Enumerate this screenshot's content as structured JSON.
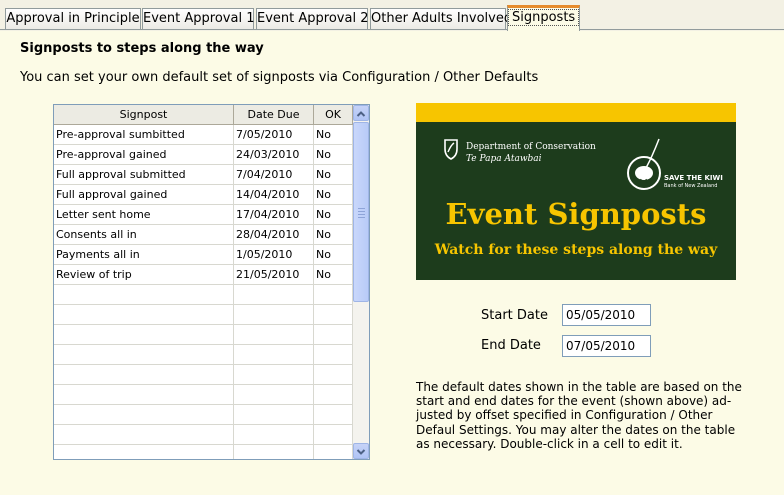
{
  "tabs": [
    {
      "label": "Approval in Principle",
      "active": false
    },
    {
      "label": "Event Approval 1",
      "active": false
    },
    {
      "label": "Event Approval 2",
      "active": false
    },
    {
      "label": "Other Adults Involved",
      "active": false
    },
    {
      "label": "Signposts",
      "active": true
    }
  ],
  "panel": {
    "heading": "Signposts to steps along the way",
    "info": "You can set your own default set of signposts via Configuration / Other Defaults"
  },
  "grid": {
    "columns": [
      "Signpost",
      "Date Due",
      "OK"
    ],
    "rows": [
      [
        "Pre-approval sumbitted",
        "7/05/2010",
        "No"
      ],
      [
        "Pre-approval gained",
        "24/03/2010",
        "No"
      ],
      [
        "Full approval submitted",
        "7/04/2010",
        "No"
      ],
      [
        "Full approval gained",
        "14/04/2010",
        "No"
      ],
      [
        "Letter sent home",
        "17/04/2010",
        "No"
      ],
      [
        "Consents all in",
        "28/04/2010",
        "No"
      ],
      [
        "Payments all in",
        "1/05/2010",
        "No"
      ],
      [
        "Review of trip",
        "21/05/2010",
        "No"
      ]
    ]
  },
  "banner": {
    "org_name": "Department of Conservation",
    "org_sub": "Te Papa Atawbai",
    "kiwi_title": "SAVE THE KIWI",
    "kiwi_bank": "Bank of New Zealand",
    "title": "Event Signposts",
    "subtitle": "Watch for these steps along the way",
    "bar_color": "#f7c500",
    "bg_color": "#1d3c1c"
  },
  "dates": {
    "start_label": "Start Date",
    "start_value": "05/05/2010",
    "end_label": "End Date",
    "end_value": "07/05/2010"
  },
  "note": "The default dates shown in the table are based on the start and end dates for the event (shown above) ad-justed by offset specified in Configuration / Other Defaul Settings. You may alter the dates on the table as necessary. Double-click in a cell to edit it.",
  "colors": {
    "accent_tab": "#e68b2c",
    "panel_bg": "#fcfbe6"
  }
}
